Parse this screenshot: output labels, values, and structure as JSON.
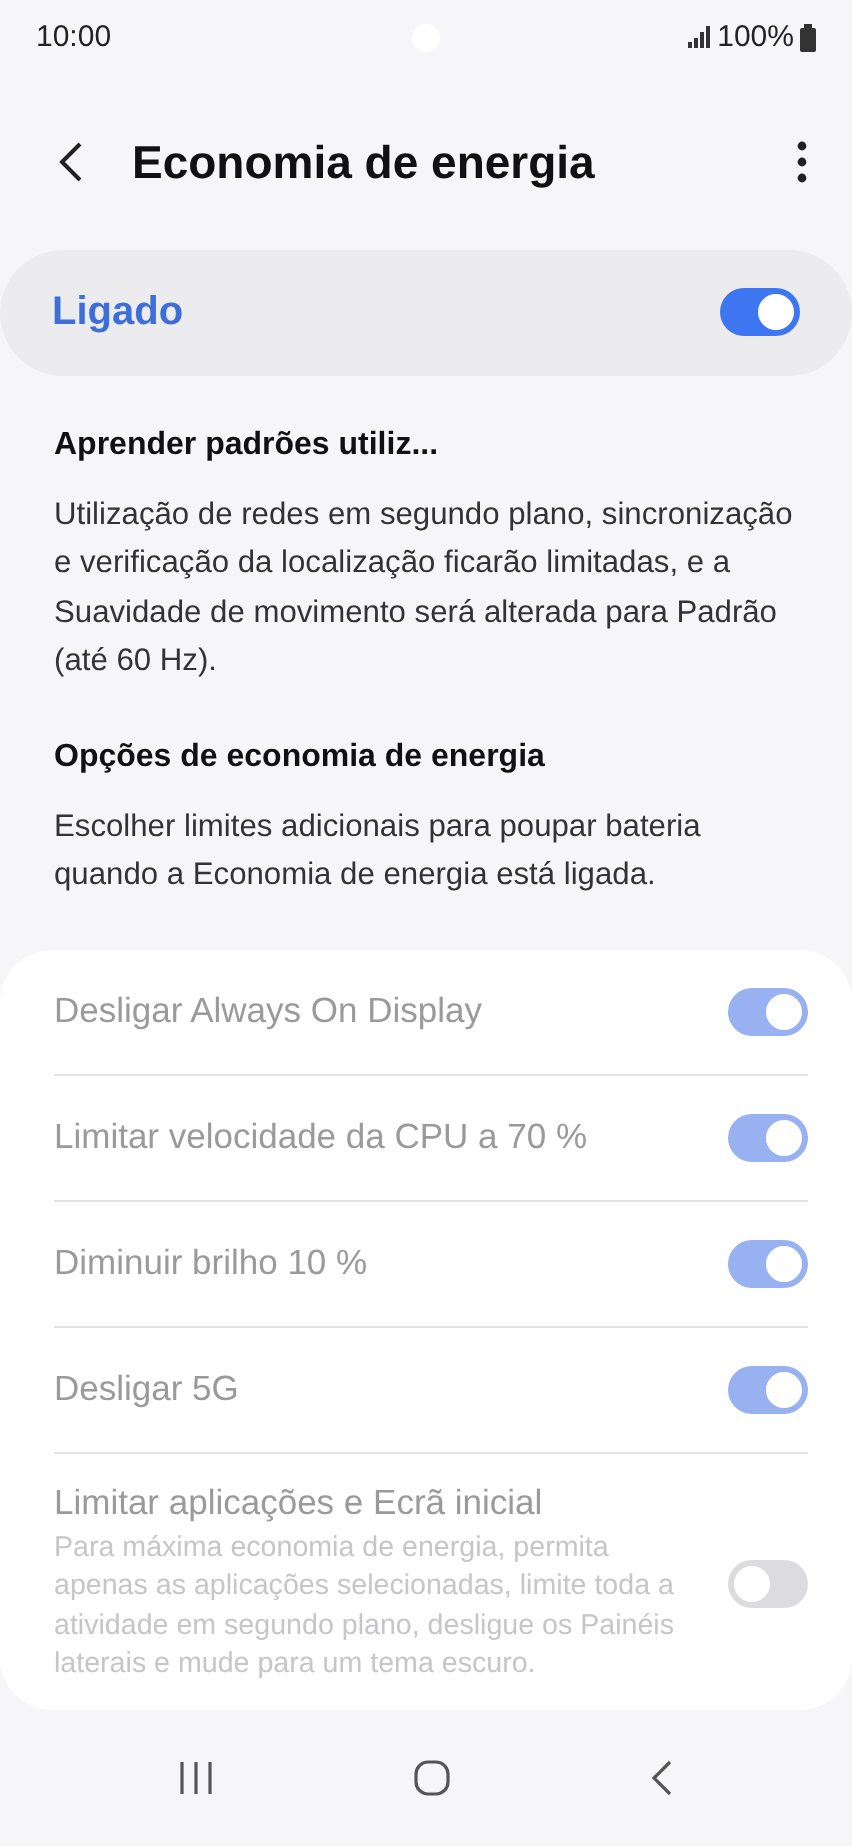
{
  "status_bar": {
    "time": "10:00",
    "battery": "100%"
  },
  "header": {
    "title": "Economia de energia"
  },
  "master": {
    "label": "Ligado",
    "on": true
  },
  "sections": [
    {
      "heading": "Aprender padrões utiliz...",
      "text": "Utilização de redes em segundo plano, sincronização e verificação da localização ficarão limitadas, e a Suavidade de movimento será alterada para Padrão (até 60 Hz)."
    },
    {
      "heading": "Opções de economia de energia",
      "text": "Escolher limites adicionais para poupar bateria quando a Economia de energia está ligada."
    }
  ],
  "options": [
    {
      "label": "Desligar Always On Display",
      "on": true,
      "disabled": true
    },
    {
      "label": "Limitar velocidade da CPU a 70 %",
      "on": true,
      "disabled": true
    },
    {
      "label": "Diminuir brilho 10 %",
      "on": true,
      "disabled": true
    },
    {
      "label": "Desligar 5G",
      "on": true,
      "disabled": true
    },
    {
      "label": "Limitar aplicações e Ecrã inicial",
      "description": "Para máxima economia de energia, permita apenas as aplicações selecionadas, limite toda a atividade em segundo plano, desligue os Painéis laterais e mude para um tema escuro.",
      "on": false,
      "disabled": true
    }
  ]
}
